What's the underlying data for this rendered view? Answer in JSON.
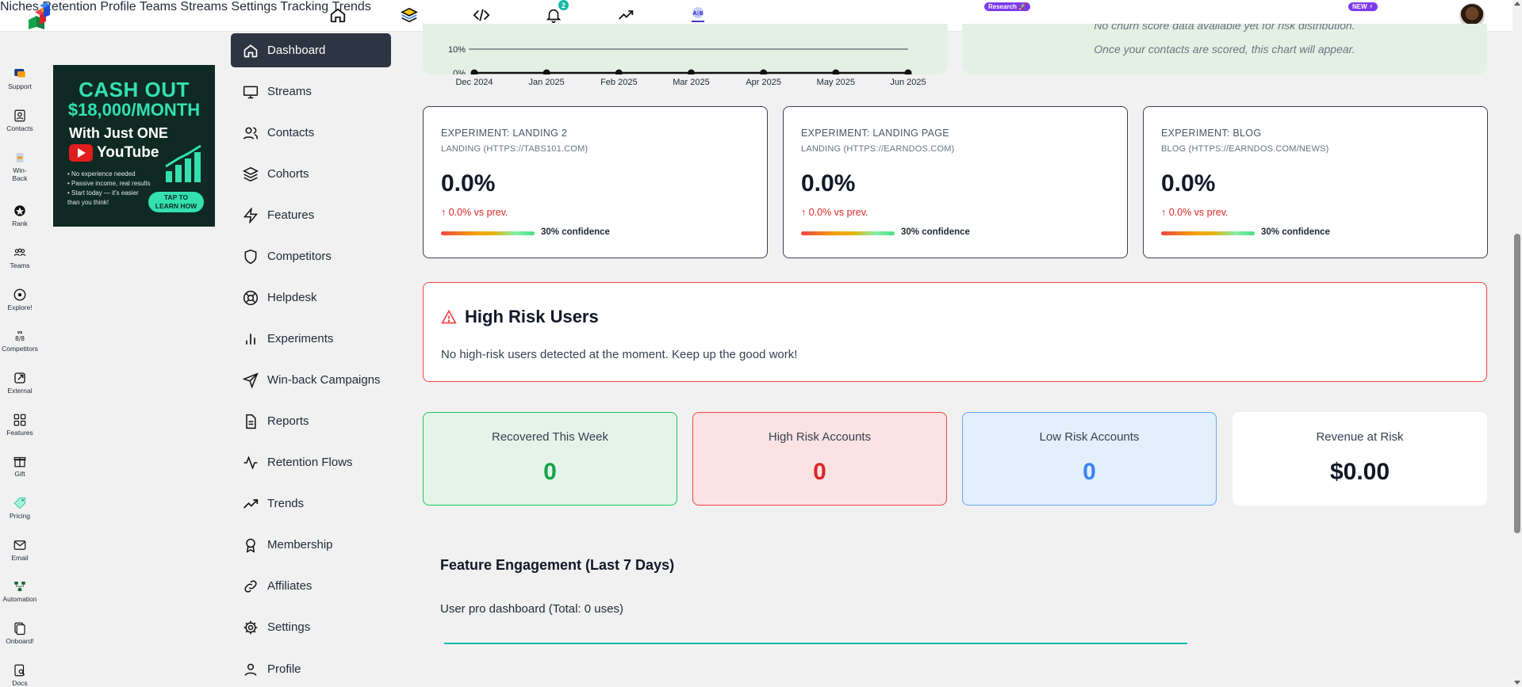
{
  "topbar": {
    "notification_count": "2",
    "nav": [
      {
        "label": "Niches",
        "badge": "Research 🚀"
      },
      {
        "label": "Retention"
      },
      {
        "label": "Profile"
      },
      {
        "label": "Teams"
      },
      {
        "label": "Streams"
      },
      {
        "label": "Settings"
      },
      {
        "label": "Tracking",
        "badge": "NEW ⚡"
      },
      {
        "label": "Trends"
      }
    ],
    "icons": [
      "home-icon",
      "layers-icon",
      "code-icon",
      "bell-icon",
      "trend-icon",
      "ab-test-icon"
    ]
  },
  "rail": {
    "items": [
      {
        "label": "Support",
        "icon": "chat-icon"
      },
      {
        "label": "Contacts",
        "icon": "contacts-icon"
      },
      {
        "label": "Win-",
        "label2": "Back",
        "icon": "winback-icon"
      },
      {
        "label": "Rank",
        "icon": "rank-icon"
      },
      {
        "label": "Teams",
        "icon": "teams-icon"
      },
      {
        "label": "Explore!",
        "icon": "explore-icon"
      },
      {
        "label": "Competitors",
        "icon": "versus-icon"
      },
      {
        "label": "External",
        "icon": "external-icon"
      },
      {
        "label": "Features",
        "icon": "grid-icon"
      },
      {
        "label": "Gift",
        "icon": "gift-icon"
      },
      {
        "label": "Pricing",
        "icon": "tag-icon"
      },
      {
        "label": "Email",
        "icon": "mail-icon"
      },
      {
        "label": "Automation",
        "icon": "flow-icon"
      },
      {
        "label": "Onboard!",
        "icon": "onboard-icon"
      },
      {
        "label": "Docs",
        "icon": "docs-icon"
      }
    ]
  },
  "ad": {
    "line1": "CASH OUT",
    "line2": "$18,000/MONTH",
    "line3": "With Just ONE",
    "line4": "YouTube",
    "bullets": [
      "• No experience needed",
      "• Passive income, real results",
      "• Start today — it's easier",
      "  than you think!"
    ],
    "cta1": "TAP TO",
    "cta2": "LEARN HOW"
  },
  "sidenav": {
    "items": [
      {
        "label": "Dashboard",
        "icon": "home-icon",
        "active": true
      },
      {
        "label": "Streams",
        "icon": "monitor-icon"
      },
      {
        "label": "Contacts",
        "icon": "users-icon"
      },
      {
        "label": "Cohorts",
        "icon": "layers-icon"
      },
      {
        "label": "Features",
        "icon": "bolt-icon"
      },
      {
        "label": "Competitors",
        "icon": "shield-icon"
      },
      {
        "label": "Helpdesk",
        "icon": "lifebuoy-icon"
      },
      {
        "label": "Experiments",
        "icon": "bar-chart-icon"
      },
      {
        "label": "Win-back Campaigns",
        "icon": "send-icon"
      },
      {
        "label": "Reports",
        "icon": "file-icon"
      },
      {
        "label": "Retention Flows",
        "icon": "activity-icon"
      },
      {
        "label": "Trends",
        "icon": "trending-icon"
      },
      {
        "label": "Membership",
        "icon": "award-icon"
      },
      {
        "label": "Affiliates",
        "icon": "link-icon"
      },
      {
        "label": "Settings",
        "icon": "gear-icon"
      },
      {
        "label": "Profile",
        "icon": "user-icon"
      }
    ]
  },
  "chart_data": {
    "type": "line",
    "x": [
      "Dec 2024",
      "Jan 2025",
      "Feb 2025",
      "Mar 2025",
      "Apr 2025",
      "May 2025",
      "Jun 2025"
    ],
    "series": [
      {
        "values": [
          0,
          0,
          0,
          0,
          0,
          0,
          0
        ]
      }
    ],
    "yticks": [
      "10%",
      "0%"
    ],
    "grid": true
  },
  "empty_chart": {
    "line1": "No churn score data available yet for risk distribution.",
    "line2": "Once your contacts are scored, this chart will appear."
  },
  "experiments": [
    {
      "title": "EXPERIMENT: LANDING 2",
      "subtitle": "LANDING (HTTPS://TABS101.COM)",
      "value": "0.0%",
      "change": "↑ 0.0% vs prev.",
      "confidence": "30% confidence"
    },
    {
      "title": "EXPERIMENT: LANDING PAGE",
      "subtitle": "LANDING (HTTPS://EARNDOS.COM)",
      "value": "0.0%",
      "change": "↑ 0.0% vs prev.",
      "confidence": "30% confidence"
    },
    {
      "title": "EXPERIMENT: BLOG",
      "subtitle": "BLOG (HTTPS://EARNDOS.COM/NEWS)",
      "value": "0.0%",
      "change": "↑ 0.0% vs prev.",
      "confidence": "30% confidence"
    }
  ],
  "high_risk": {
    "title": "High Risk Users",
    "message": "No high-risk users detected at the moment. Keep up the good work!"
  },
  "stats": [
    {
      "label": "Recovered This Week",
      "value": "0",
      "color": "#16a34a",
      "bg": "#e4f4e8",
      "border": "#22c55e"
    },
    {
      "label": "High Risk Accounts",
      "value": "0",
      "color": "#dc2626",
      "bg": "#fbe3e3",
      "border": "#ef4444"
    },
    {
      "label": "Low Risk Accounts",
      "value": "0",
      "color": "#3b82f6",
      "bg": "#e3effb",
      "border": "#60a5fa"
    },
    {
      "label": "Revenue at Risk",
      "value": "$0.00",
      "color": "#111827",
      "bg": "#ffffff",
      "border": "#ffffff"
    }
  ],
  "feature_engagement": {
    "title": "Feature Engagement (Last 7 Days)",
    "subtitle": "User pro dashboard (Total: 0 uses)"
  }
}
